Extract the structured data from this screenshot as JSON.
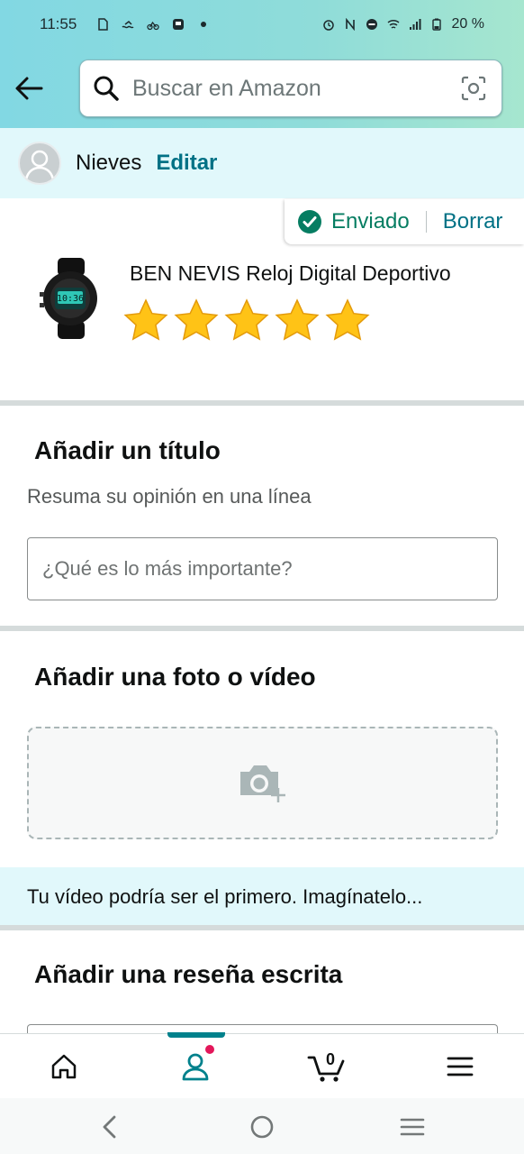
{
  "status_bar": {
    "time": "11:55",
    "battery": "20 %"
  },
  "search": {
    "placeholder": "Buscar en Amazon"
  },
  "profile": {
    "name": "Nieves",
    "edit_label": "Editar"
  },
  "status_tab": {
    "sent_label": "Enviado",
    "delete_label": "Borrar"
  },
  "product": {
    "title": "BEN NEVIS Reloj Digital Deportivo",
    "rating": 5,
    "rating_max": 5
  },
  "title_section": {
    "heading": "Añadir un título",
    "subheading": "Resuma su opinión en una línea",
    "placeholder": "¿Qué es lo más importante?"
  },
  "media_section": {
    "heading": "Añadir una foto o vídeo"
  },
  "tip": {
    "text": "Tu vídeo podría ser el primero. Imagínatelo..."
  },
  "review_section": {
    "heading": "Añadir una reseña escrita"
  },
  "bottom_nav": {
    "cart_count": "0",
    "active": "profile"
  },
  "colors": {
    "accent": "#007185",
    "success": "#067d62",
    "star": "#ffa41c",
    "nav_indicator": "#00818c",
    "notification_dot": "#e3175a"
  }
}
